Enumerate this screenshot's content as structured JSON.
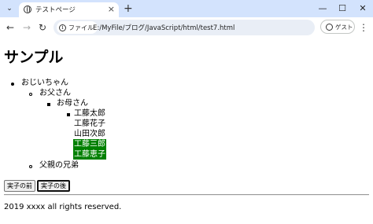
{
  "browser": {
    "tab_title": "テストページ",
    "tab_close": "×",
    "new_tab": "+",
    "window_controls": {
      "minimize": "—",
      "maximize": "☐",
      "close": "✕"
    },
    "tab_dropdown": "⌄",
    "nav": {
      "back": "←",
      "forward": "→",
      "reload": "↻"
    },
    "site_info_label": "ファイル",
    "url": "E:/MyFile/ブログ/JavaScript/html/test7.html",
    "guest_label": "ゲスト",
    "menu": "⋮"
  },
  "page": {
    "heading": "サンプル",
    "tree": {
      "level1": "おじいちゃん",
      "level2_a": "お父さん",
      "level3": "お母さん",
      "children": [
        "工藤太郎",
        "工藤花子",
        "山田次郎",
        "工藤三郎",
        "工藤恵子"
      ],
      "level2_b": "父親の兄弟"
    },
    "buttons": {
      "before": "実子の前",
      "after": "実子の後"
    },
    "footer": "2019 xxxx all rights reserved."
  },
  "colors": {
    "highlight": "#008000",
    "tabstrip": "#d3e3fd"
  }
}
